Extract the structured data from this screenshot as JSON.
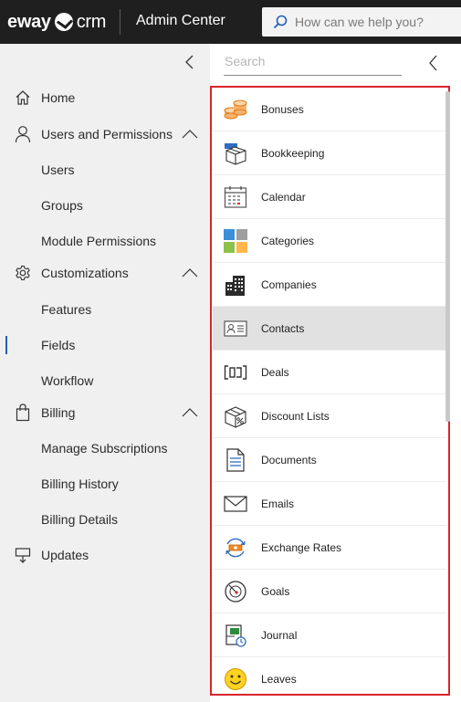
{
  "header": {
    "logo_text_1": "eway",
    "logo_text_2": "crm",
    "app_title": "Admin Center",
    "search_placeholder": "How can we help you?"
  },
  "left_nav": {
    "items": [
      {
        "label": "Home",
        "icon": "home-icon"
      },
      {
        "label": "Users and Permissions",
        "icon": "user-icon",
        "expanded": true
      },
      {
        "label": "Users"
      },
      {
        "label": "Groups"
      },
      {
        "label": "Module Permissions"
      },
      {
        "label": "Customizations",
        "icon": "gear-icon",
        "expanded": true
      },
      {
        "label": "Features"
      },
      {
        "label": "Fields",
        "active": true
      },
      {
        "label": "Workflow"
      },
      {
        "label": "Billing",
        "icon": "shopping-bag-icon",
        "expanded": true
      },
      {
        "label": "Manage Subscriptions"
      },
      {
        "label": "Billing History"
      },
      {
        "label": "Billing Details"
      },
      {
        "label": "Updates",
        "icon": "updates-icon"
      }
    ]
  },
  "module_list": {
    "search_placeholder": "Search",
    "selected": "Contacts",
    "items": [
      {
        "label": "Bonuses",
        "icon": "coins-icon"
      },
      {
        "label": "Bookkeeping",
        "icon": "box-icon"
      },
      {
        "label": "Calendar",
        "icon": "calendar-icon"
      },
      {
        "label": "Categories",
        "icon": "categories-icon"
      },
      {
        "label": "Companies",
        "icon": "building-icon"
      },
      {
        "label": "Contacts",
        "icon": "contact-card-icon"
      },
      {
        "label": "Deals",
        "icon": "deal-icon"
      },
      {
        "label": "Discount Lists",
        "icon": "discount-box-icon"
      },
      {
        "label": "Documents",
        "icon": "document-icon"
      },
      {
        "label": "Emails",
        "icon": "envelope-icon"
      },
      {
        "label": "Exchange Rates",
        "icon": "exchange-icon"
      },
      {
        "label": "Goals",
        "icon": "target-icon"
      },
      {
        "label": "Journal",
        "icon": "journal-icon"
      },
      {
        "label": "Leaves",
        "icon": "smiley-icon"
      }
    ]
  },
  "colors": {
    "topbar": "#1f1f1f",
    "left_nav_bg": "#f0f0f0",
    "active_indicator": "#2a5db0",
    "list_frame_border": "#d9242b",
    "selected_row": "#e1e1e1"
  }
}
